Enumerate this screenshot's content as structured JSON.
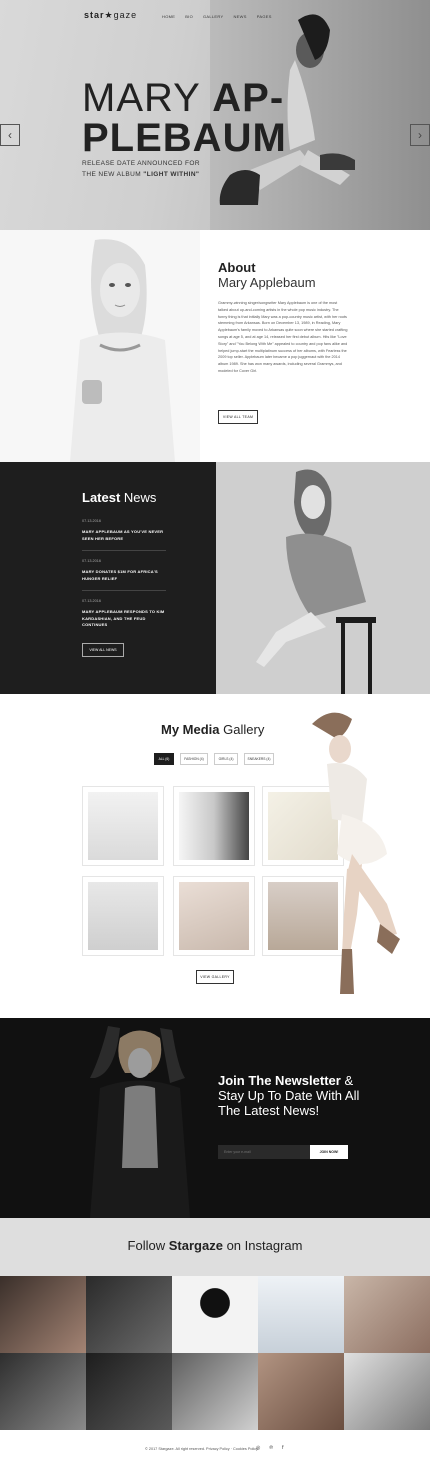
{
  "header": {
    "logo_prefix": "star",
    "logo_suffix": "gaze",
    "nav": [
      "HOME",
      "BIO",
      "GALLERY",
      "NEWS",
      "PAGES"
    ]
  },
  "hero": {
    "title_light": "MARY",
    "title_bold_1": "AP-",
    "title_bold_2": "PLEBAUM",
    "sub_line_1": "RELEASE DATE ANNOUNCED FOR",
    "sub_line_2": "THE NEW ALBUM",
    "sub_line_2_bold": "\"LIGHT WITHIN\"",
    "prev_arrow": "‹",
    "next_arrow": "›"
  },
  "about": {
    "heading": "About",
    "subheading": "Mary Applebaum",
    "body": "Grammy-winning singer/songwriter Mary Applebaum is one of the most talked about up-and-coming artists in the whole pop music industry. The funny thing is that initially Mary was a pop-country music artist, with her roots stemming from Arkansas. Born on December 13, 1989, in Reading, Mary Applebaum's family moved to Arkansas quite soon where she started crafting songs at age 5, and at age 14, released her first debut album. Hits like \"Love Story\" and \"You Belong With Me\" appealed to country and pop fans alike and helped jump-start the multiplatinum success of her albums, with Fearless the 2009 top seller. Applebaum later became a pop juggernaut with the 2014 album 1989. She has won many awards, including several Grammys, and modeled for Cover Girl.",
    "button": "VIEW ALL TEAM"
  },
  "news": {
    "heading_bold": "Latest",
    "heading_light": "News",
    "items": [
      {
        "date": "07.13.2016",
        "title": "MARY APPLEBAUM AS YOU'VE NEVER SEEN HER BEFORE"
      },
      {
        "date": "07.13.2016",
        "title": "MARY DONATES $1M FOR AFRICA'S HUNGER RELIEF"
      },
      {
        "date": "07.13.2016",
        "title": "MARY APPLEBAUM RESPONDS TO KIM KARDASHIAN, AND THE FEUD CONTINUES"
      }
    ],
    "button": "VIEW ALL NEWS"
  },
  "gallery": {
    "heading_bold": "My Media",
    "heading_light": "Gallery",
    "filters": [
      "ALL (6)",
      "FASHION (4)",
      "GIRLS (4)",
      "SNEAKERS (4)"
    ],
    "active_filter": 0,
    "button": "VIEW GALLERY"
  },
  "newsletter": {
    "heading_bold": "Join The Newsletter",
    "heading_light": "& Stay Up To Date With All The Latest News!",
    "placeholder": "Enter your e-mail",
    "button": "JOIN NOW!"
  },
  "instagram": {
    "heading_prefix": "Follow",
    "heading_bold": "Stargaze",
    "heading_suffix": "on Instagram"
  },
  "footer": {
    "copyright": "© 2017 Stargaze. All right reserved. Privacy Policy · Cookies Policy",
    "social": [
      "◎",
      "℗",
      "f"
    ]
  }
}
